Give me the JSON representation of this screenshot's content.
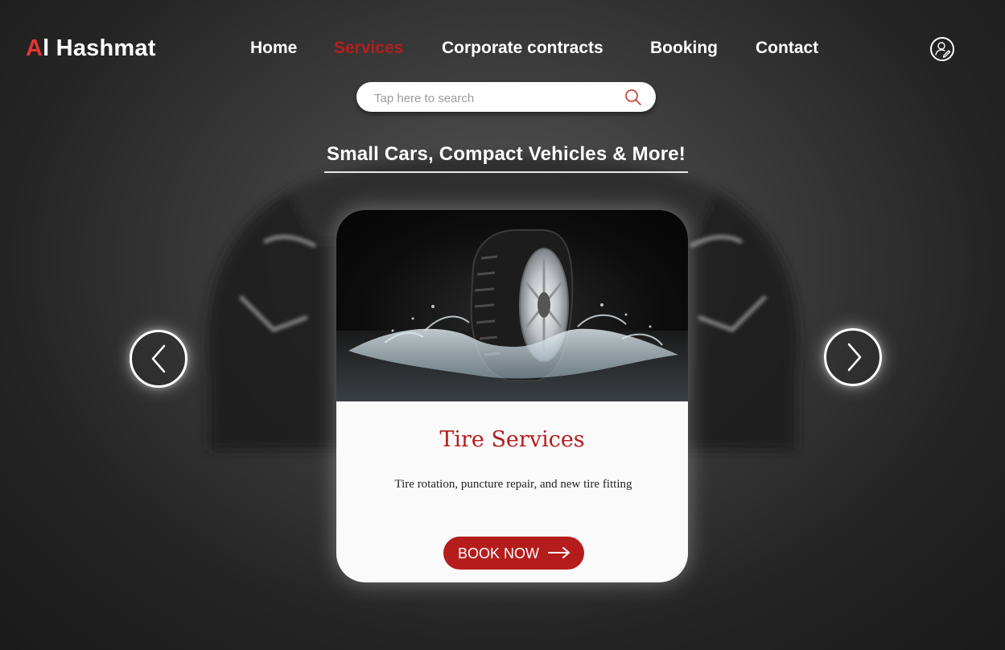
{
  "brand": {
    "accent_letter": "A",
    "rest": "l Hashmat",
    "accent_color": "#e23434"
  },
  "nav": {
    "items": [
      {
        "label": "Home"
      },
      {
        "label": "Services",
        "active": true
      },
      {
        "label": "Corporate contracts"
      },
      {
        "label": "Booking"
      },
      {
        "label": "Contact"
      }
    ],
    "active_color": "#b51d1d",
    "user_icon": "user-icon"
  },
  "search": {
    "placeholder": "Tap here to search",
    "value": "",
    "icon": "search-icon"
  },
  "headline": "Small Cars, Compact Vehicles & More!",
  "carousel": {
    "prev_icon": "chevron-left-icon",
    "next_icon": "chevron-right-icon"
  },
  "card": {
    "image": "tire-splash-image",
    "title": "Tire Services",
    "description": "Tire rotation, puncture repair, and new tire fitting",
    "button_label": "BOOK NOW",
    "button_icon": "arrow-right-icon",
    "button_color": "#b51d1d"
  }
}
